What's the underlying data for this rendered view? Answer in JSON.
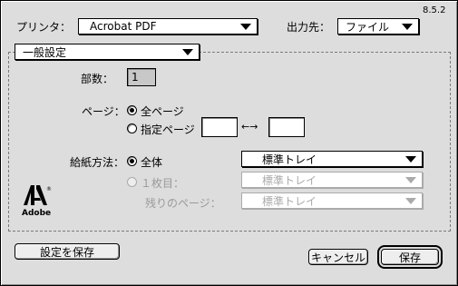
{
  "version": "8.5.2",
  "printer": {
    "label": "プリンタ：",
    "value": "Acrobat PDF"
  },
  "destination": {
    "label": "出力先：",
    "value": "ファイル"
  },
  "panel": {
    "value": "一般設定"
  },
  "copies": {
    "label": "部数：",
    "value": "1"
  },
  "pages": {
    "label": "ページ：",
    "all_label": "全ページ",
    "range_label": "指定ページ",
    "from": "",
    "to": "",
    "separator": "←→"
  },
  "paper_source": {
    "label": "給紙方法：",
    "all_label": "全体",
    "all_value": "標準トレイ",
    "first_label": "１枚目：",
    "first_value": "標準トレイ",
    "remaining_label": "残りのページ：",
    "remaining_value": "標準トレイ"
  },
  "logo": {
    "text": "Adobe"
  },
  "buttons": {
    "save_settings": "設定を保存",
    "cancel": "キャンセル",
    "save": "保存"
  }
}
